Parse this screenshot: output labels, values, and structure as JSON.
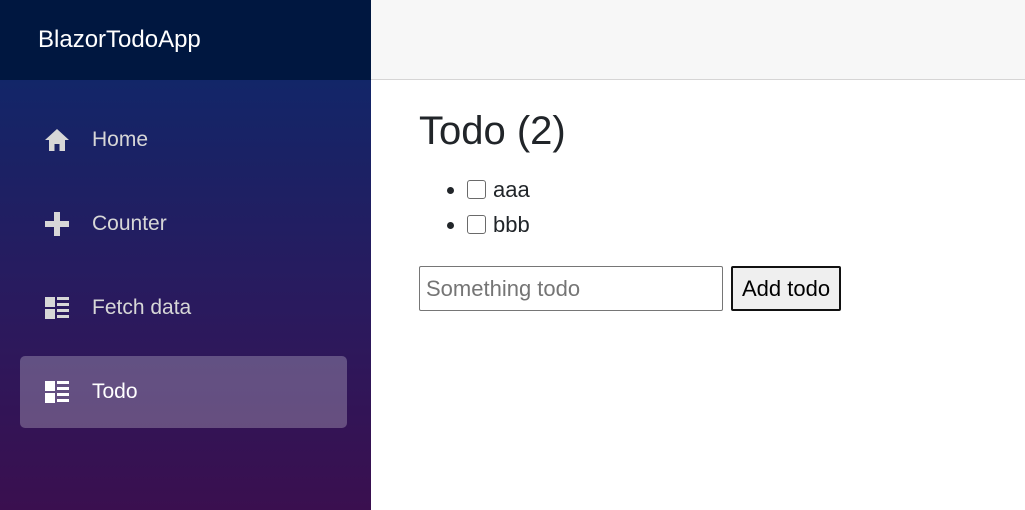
{
  "app": {
    "brand": "BlazorTodoApp"
  },
  "nav": {
    "items": [
      {
        "label": "Home",
        "icon": "home-icon"
      },
      {
        "label": "Counter",
        "icon": "plus-icon"
      },
      {
        "label": "Fetch data",
        "icon": "list-icon"
      },
      {
        "label": "Todo",
        "icon": "list-icon",
        "active": true
      }
    ]
  },
  "page": {
    "title": "Todo (2)",
    "todos": [
      {
        "title": "aaa",
        "done": false
      },
      {
        "title": "bbb",
        "done": false
      }
    ],
    "input": {
      "placeholder": "Something todo",
      "value": ""
    },
    "add_label": "Add todo"
  },
  "colors": {
    "brand_bar": "#001740",
    "sidebar_top": "#0a2a6c",
    "sidebar_bottom": "#3a0f4f",
    "topbar": "#f7f7f7"
  }
}
